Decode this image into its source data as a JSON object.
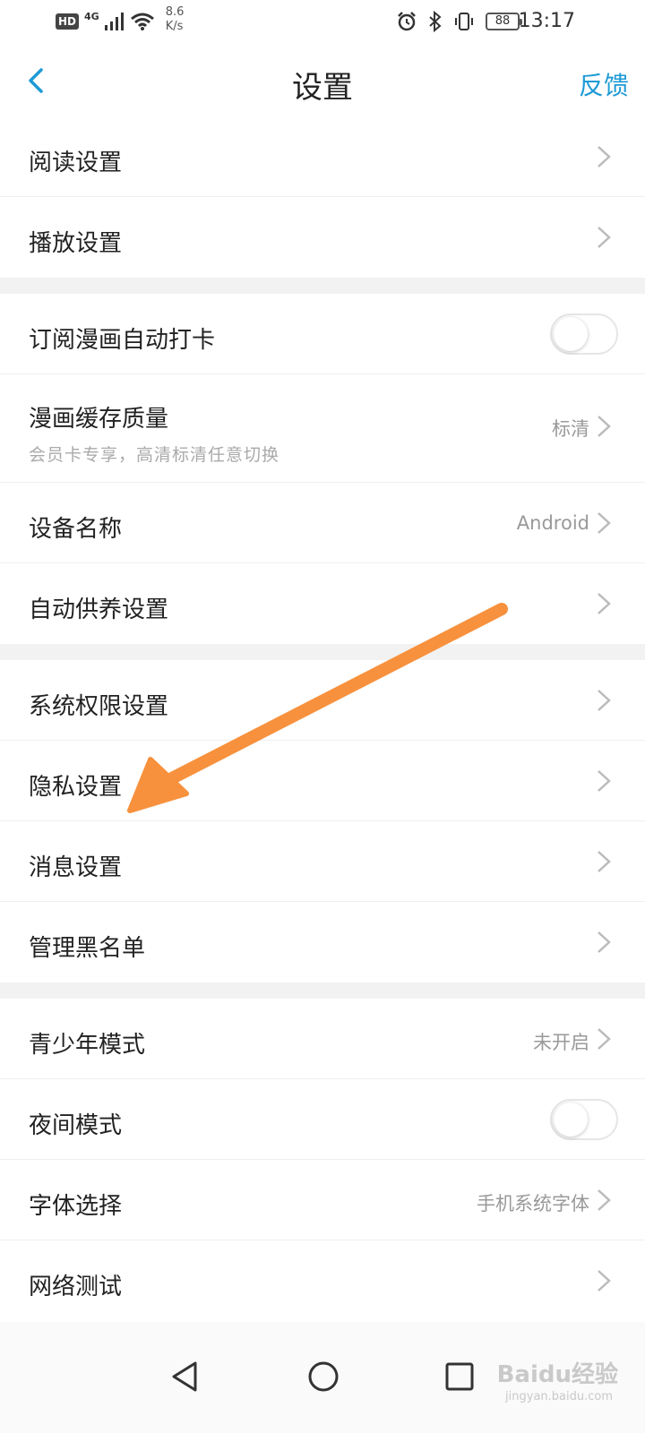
{
  "status_bar": {
    "hd": "HD",
    "network": "4G",
    "speed_value": "8.6",
    "speed_unit": "K/s",
    "battery": "88",
    "time": "13:17"
  },
  "header": {
    "title": "设置",
    "feedback": "反馈"
  },
  "settings": {
    "reading": {
      "label": "阅读设置"
    },
    "playback": {
      "label": "播放设置"
    },
    "auto_checkin": {
      "label": "订阅漫画自动打卡",
      "enabled": false
    },
    "cache_quality": {
      "label": "漫画缓存质量",
      "sub": "会员卡专享，高清标清任意切换",
      "value": "标清"
    },
    "device_name": {
      "label": "设备名称",
      "value": "Android"
    },
    "auto_support": {
      "label": "自动供养设置"
    },
    "permissions": {
      "label": "系统权限设置"
    },
    "privacy": {
      "label": "隐私设置"
    },
    "messages": {
      "label": "消息设置"
    },
    "blacklist": {
      "label": "管理黑名单"
    },
    "youth_mode": {
      "label": "青少年模式",
      "value": "未开启"
    },
    "night_mode": {
      "label": "夜间模式",
      "enabled": false
    },
    "font": {
      "label": "字体选择",
      "value": "手机系统字体"
    },
    "network_test": {
      "label": "网络测试"
    }
  },
  "watermark": {
    "brand": "Baidu经验",
    "url": "jingyan.baidu.com"
  },
  "colors": {
    "accent": "#1d9ad6",
    "annotation_arrow": "#f7913d",
    "section_gap": "#f2f2f2"
  }
}
